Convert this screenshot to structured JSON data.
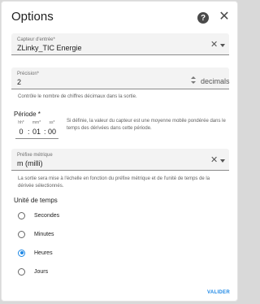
{
  "dialog": {
    "title": "Options"
  },
  "sensor_field": {
    "label": "Capteur d'entrée*",
    "value": "ZLinky_TIC Energie"
  },
  "precision_field": {
    "label": "Précision*",
    "value": "2",
    "suffix": "decimals",
    "helper": "Contrôle le nombre de chiffres décimaux dans la sortie."
  },
  "period": {
    "title": "Période *",
    "hours_label": "hh*",
    "hours_value": "0",
    "minutes_label": "mm*",
    "minutes_value": "01",
    "seconds_label": "ss*",
    "seconds_value": "00",
    "separator": ":",
    "helper": "Si définie, la valeur du capteur est une moyenne mobile pondérée dans le temps des dérivées dans cette période."
  },
  "prefix_field": {
    "label": "Préfixe métrique",
    "value": "m (milli)",
    "helper": "La sortie sera mise à l'échelle en fonction du préfixe métrique et de l'unité de temps de la dérivée sélectionnés."
  },
  "time_unit": {
    "title": "Unité de temps",
    "options": [
      {
        "label": "Secondes",
        "checked": false
      },
      {
        "label": "Minutes",
        "checked": false
      },
      {
        "label": "Heures",
        "checked": true
      },
      {
        "label": "Jours",
        "checked": false
      }
    ]
  },
  "actions": {
    "validate_label": "VALIDER"
  },
  "colors": {
    "accent": "#1e88e5"
  }
}
